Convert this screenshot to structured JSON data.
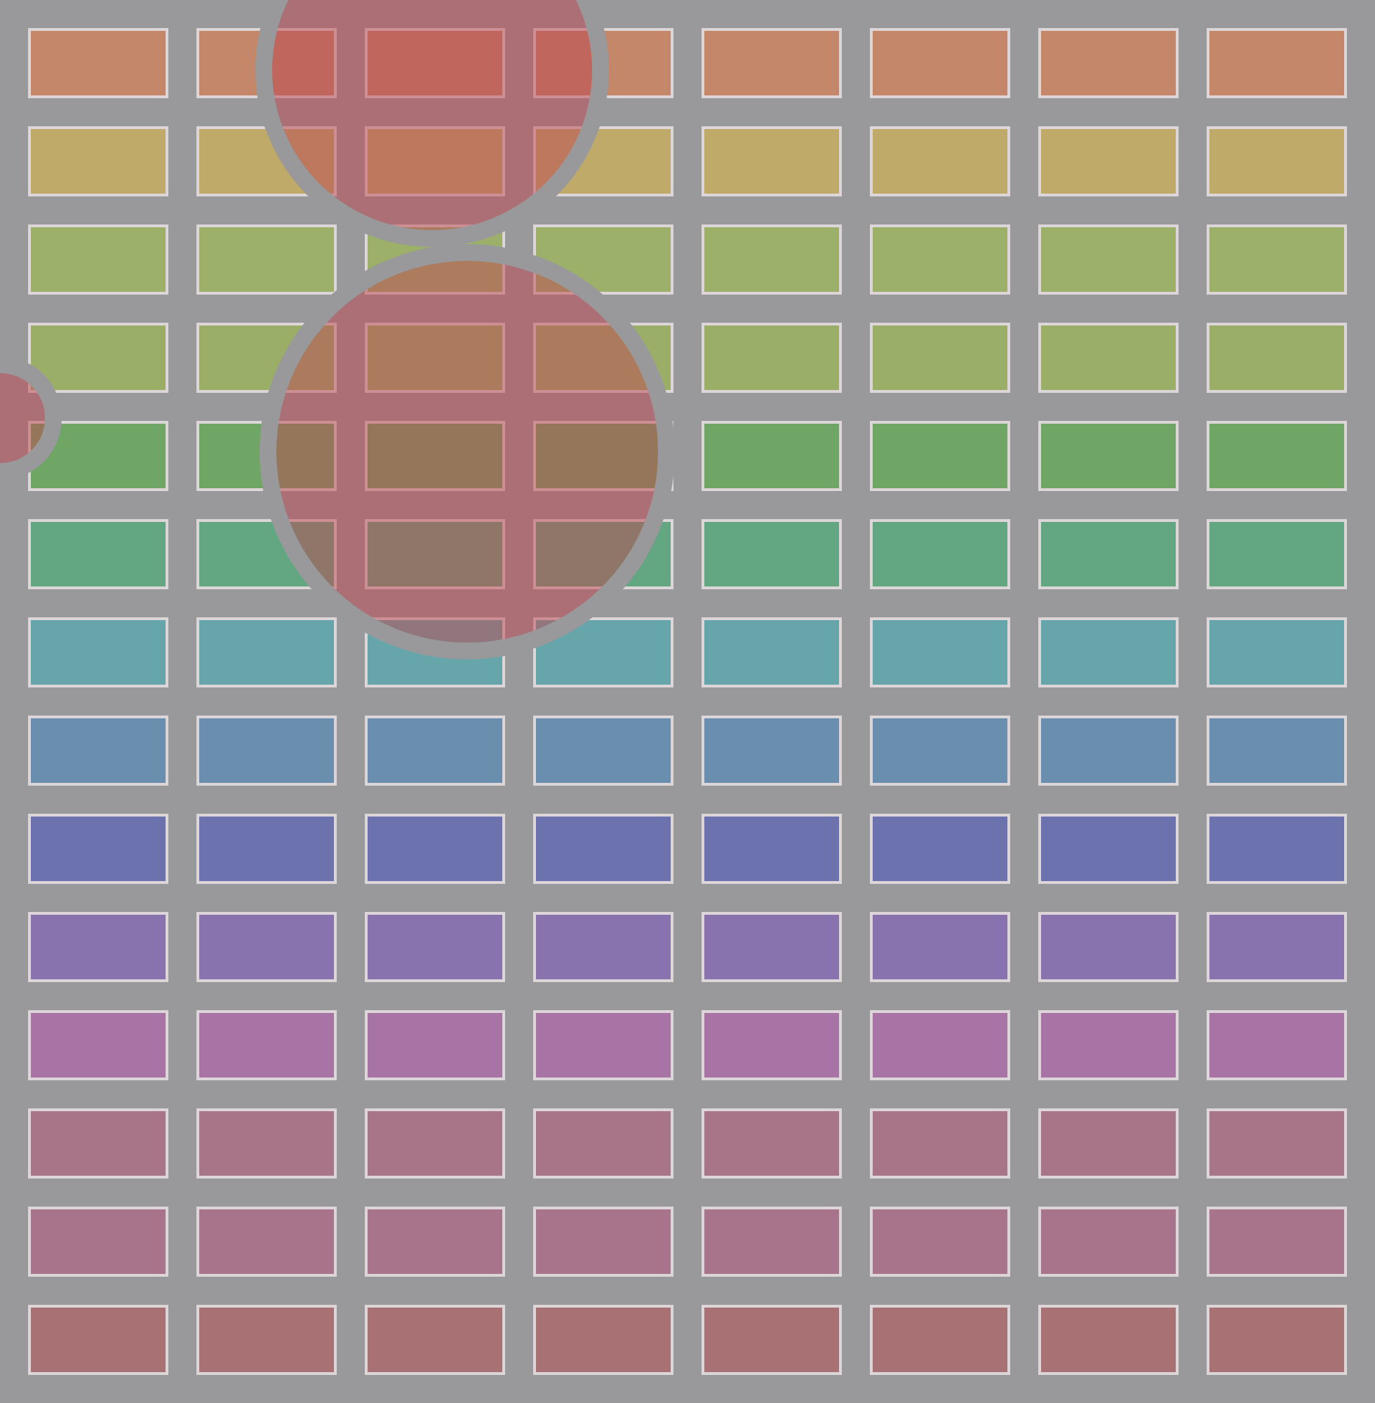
{
  "rows": [
    {
      "color": "#c5876a"
    },
    {
      "color": "#bfaa6a"
    },
    {
      "color": "#9cb06a"
    },
    {
      "color": "#9aae68"
    },
    {
      "color": "#6fa665"
    },
    {
      "color": "#62a682"
    },
    {
      "color": "#66a6aa"
    },
    {
      "color": "#6a8eae"
    },
    {
      "color": "#6c72ae"
    },
    {
      "color": "#8873ae"
    },
    {
      "color": "#a874a6"
    },
    {
      "color": "#a87488"
    },
    {
      "color": "#a8748c"
    },
    {
      "color": "#a87274"
    }
  ]
}
